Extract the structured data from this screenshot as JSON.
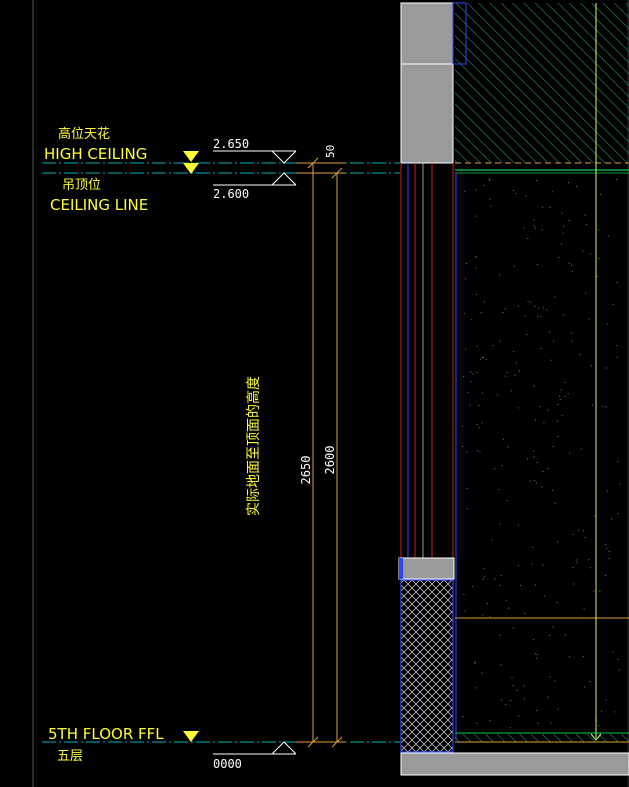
{
  "levels": {
    "high_ceiling": {
      "label_cn": "高位天花",
      "label_en": "HIGH CEILING",
      "elevation": "2.650"
    },
    "ceiling_line": {
      "label_cn": "吊顶位",
      "label_en": "CEILING LINE",
      "elevation": "2.600"
    },
    "fifth_floor": {
      "label_en": "5TH FLOOR FFL",
      "label_cn": "五层",
      "elevation": "0000"
    }
  },
  "dimensions": {
    "top_gap": "50",
    "to_high_ceiling": "2650",
    "to_ceiling_line": "2600"
  },
  "annotation": {
    "vertical_note": "实际地面至顶面的高度"
  },
  "colors": {
    "background": "#000000",
    "text_yellow": "#ffff33",
    "level_line_cyan": "#00b3b3",
    "dimension_orange": "#e0a040",
    "hatch_green": "#2f8f6a",
    "wall_gray": "#9a9a9a",
    "frame_red": "#cc2222",
    "frame_blue": "#3344ff",
    "guide_green": "#ccff66"
  }
}
